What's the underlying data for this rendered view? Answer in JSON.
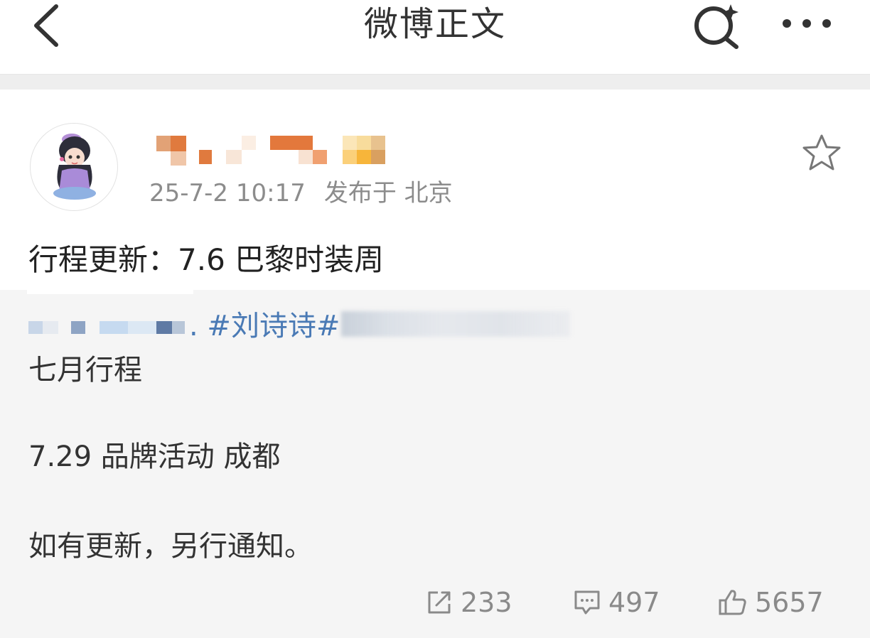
{
  "header": {
    "title": "微博正文"
  },
  "post": {
    "timestamp": "25-7-2 10:17",
    "location": "发布于 北京",
    "headline": "行程更新：7.6 巴黎时装周",
    "topic_visible": ". #刘诗诗#",
    "lines": [
      "七月行程",
      "7.29 品牌活动 成都",
      "如有更新，另行通知。"
    ]
  },
  "actions": {
    "repost_count": "233",
    "comment_count": "497",
    "like_count": "5657"
  },
  "icons": {
    "back": "chevron-left-icon",
    "search": "search-sparkle-icon",
    "more": "more-dots-icon",
    "favorite": "star-outline-icon",
    "repost": "repost-icon",
    "comment": "comment-icon",
    "like": "thumbs-up-icon"
  },
  "colors": {
    "topic_link": "#4a7ab5",
    "meta_gray": "#8c8c8c",
    "body_bg": "#f5f5f5"
  }
}
